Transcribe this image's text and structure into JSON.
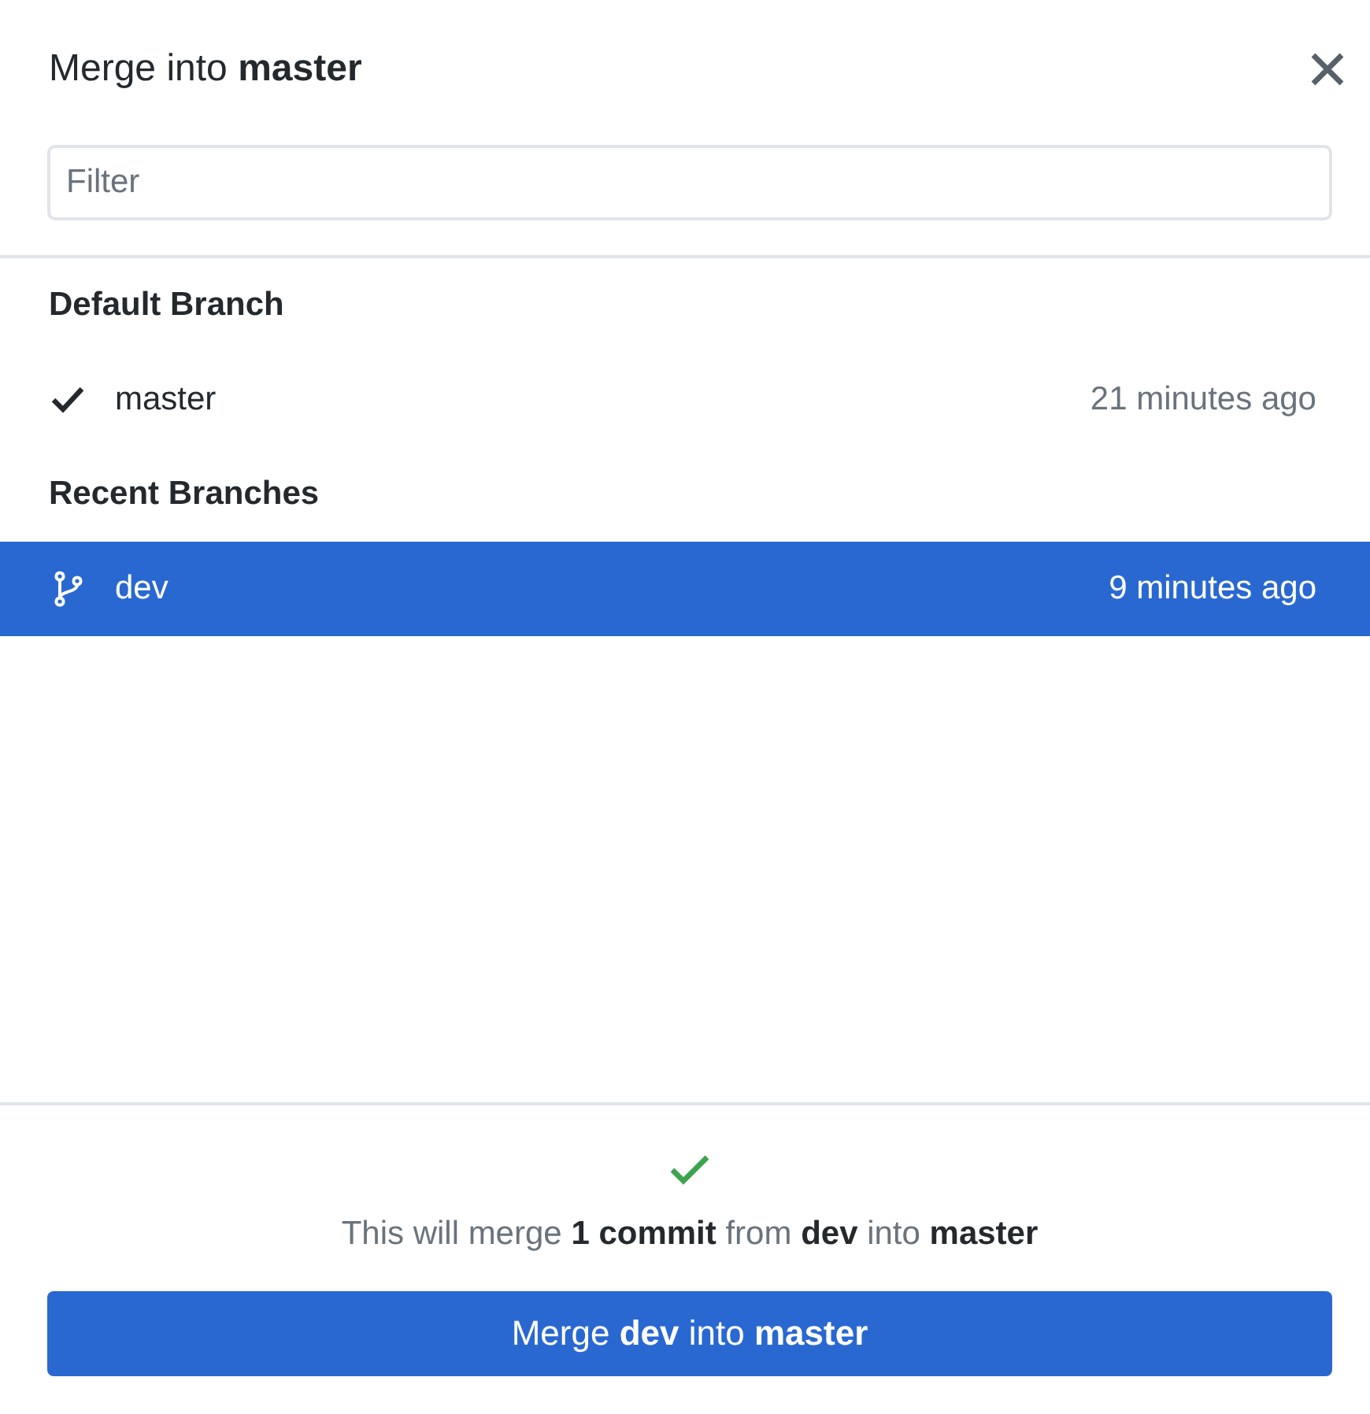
{
  "dialog": {
    "title": "Merge into **master**"
  },
  "filter": {
    "placeholder": "Filter"
  },
  "groups": [
    {
      "header": "Default Branch",
      "branches": [
        {
          "name": "master",
          "time": "21 minutes ago",
          "current": true,
          "selected": false
        }
      ]
    },
    {
      "header": "Recent Branches",
      "branches": [
        {
          "name": "dev",
          "time": "9 minutes ago",
          "current": false,
          "selected": true
        }
      ]
    }
  ],
  "status": {
    "ok": true,
    "message": "This will merge **1 commit** from **dev** into **master**"
  },
  "merge_button": {
    "label": "Merge **dev** into **master**"
  }
}
